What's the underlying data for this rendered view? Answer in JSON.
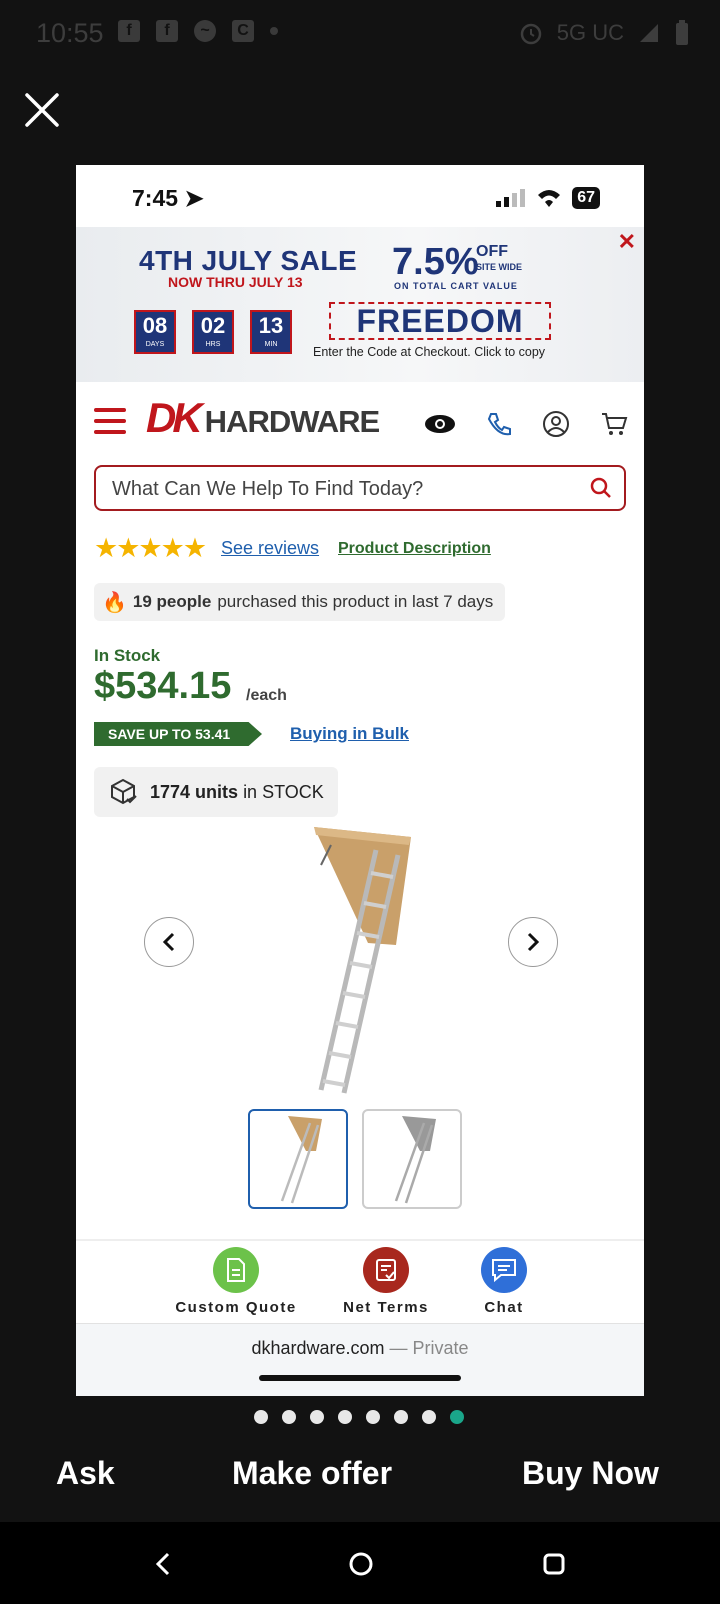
{
  "android_status": {
    "time": "10:55",
    "network": "5G UC",
    "icons_left": [
      "facebook-icon",
      "facebook-icon",
      "messenger-icon",
      "c-icon"
    ]
  },
  "ios_status": {
    "time": "7:45",
    "battery": "67"
  },
  "banner": {
    "title": "4TH JULY SALE",
    "subtitle": "NOW THRU JULY 13",
    "discount": "7.5%",
    "off_label": "OFF",
    "site_wide": "SITE WIDE",
    "cart_note": "ON TOTAL CART VALUE",
    "countdown": [
      {
        "value": "08",
        "unit": "DAYS"
      },
      {
        "value": "02",
        "unit": "HRS"
      },
      {
        "value": "13",
        "unit": "MIN"
      }
    ],
    "code": "FREEDOM",
    "code_hint": "Enter the Code at Checkout. Click to copy"
  },
  "brand": {
    "dk": "DK",
    "hardware": "HARDWARE",
    "accent": "#c0161c"
  },
  "search": {
    "placeholder": "What Can We Help To Find Today?"
  },
  "reviews": {
    "stars": "★★★★★",
    "see_reviews": "See reviews",
    "product_description": "Product Description"
  },
  "purchase_note": {
    "count": "19 people",
    "text": "purchased this product in last 7 days"
  },
  "product": {
    "stock_status": "In Stock",
    "price": "$534.15",
    "per": "/each",
    "save_badge": "SAVE UP TO 53.41",
    "bulk_link": "Buying in Bulk",
    "units": "1774 units",
    "units_suffix": "in STOCK"
  },
  "bottom_bar": {
    "custom_quote": "Custom Quote",
    "net_terms": "Net Terms",
    "chat": "Chat"
  },
  "browser": {
    "domain": "dkhardware.com",
    "private": "— Private"
  },
  "pager": {
    "count": 8,
    "active": 7
  },
  "actions": {
    "ask": "Ask",
    "make_offer": "Make offer",
    "buy_now": "Buy Now"
  }
}
